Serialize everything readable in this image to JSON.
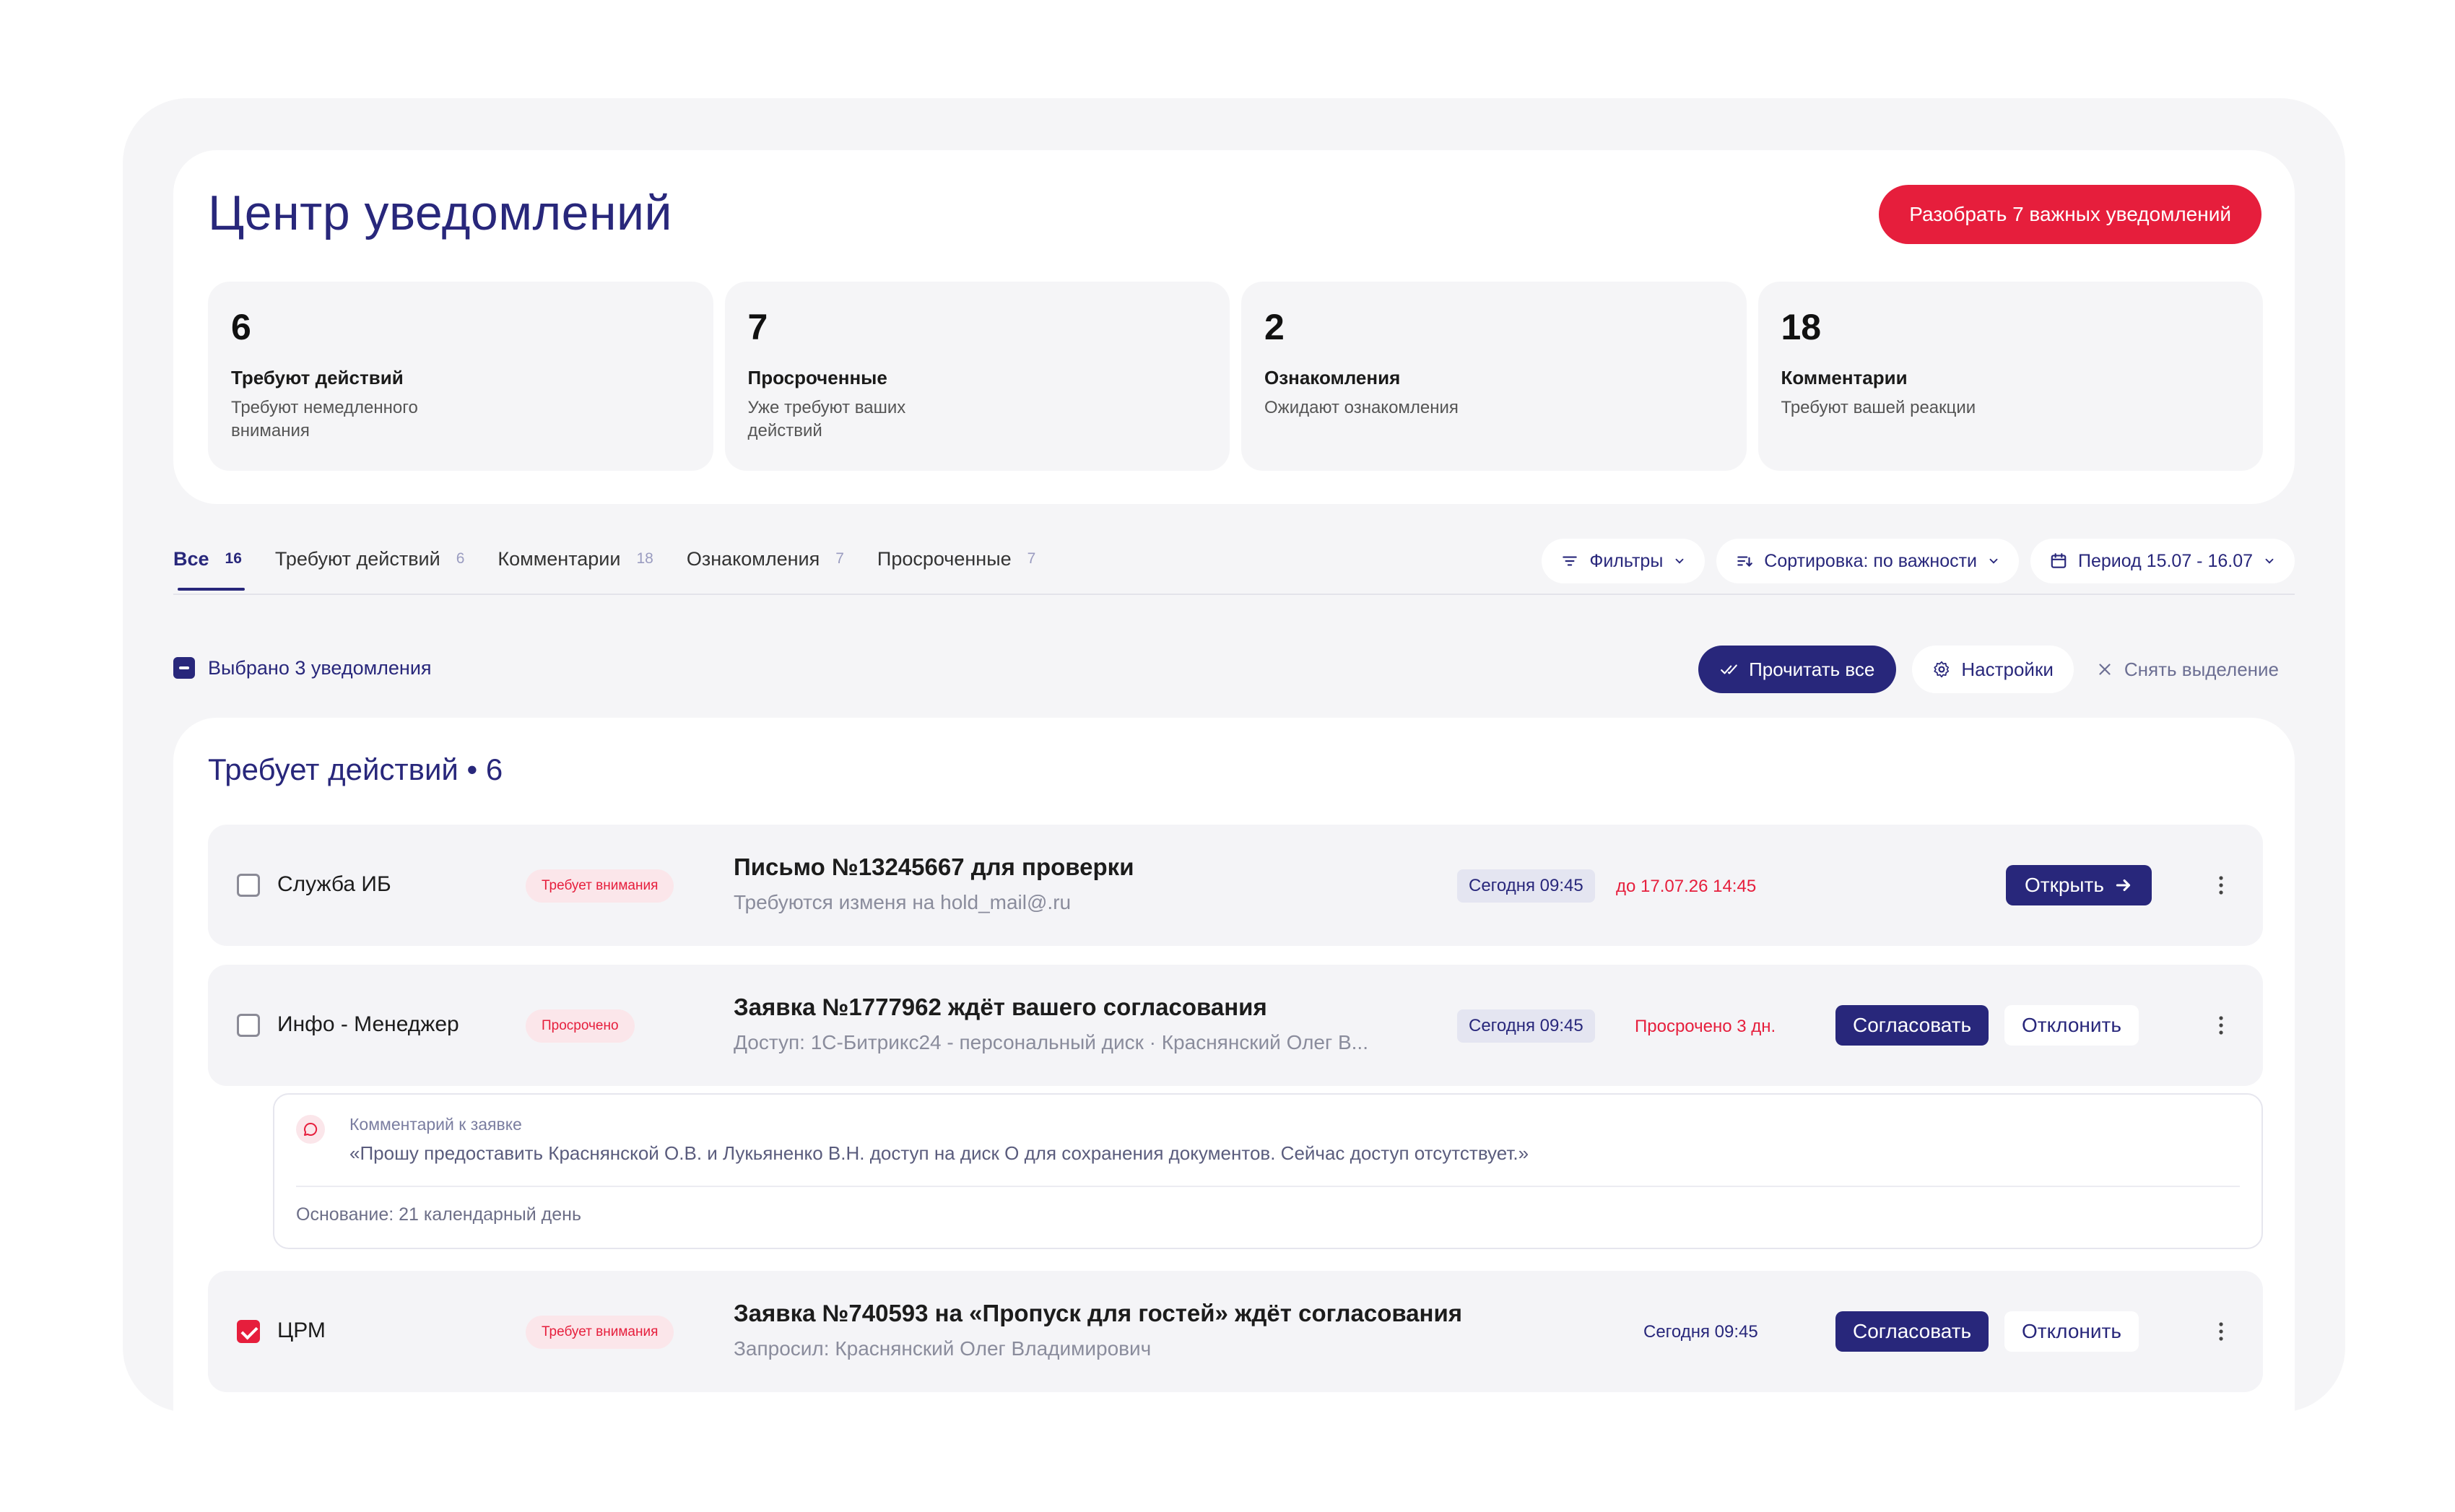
{
  "header": {
    "title": "Центр уведомлений",
    "cta_label": "Разобрать 7 важных уведомлений",
    "accent_color": "#e61e3c",
    "brand_color": "#28277b"
  },
  "stats": [
    {
      "value": "6",
      "title": "Требуют действий",
      "desc": "Требуют немедленного внимания"
    },
    {
      "value": "7",
      "title": "Просроченные",
      "desc": "Уже требуют ваших действий"
    },
    {
      "value": "2",
      "title": "Ознакомления",
      "desc": "Ожидают ознакомления"
    },
    {
      "value": "18",
      "title": "Комментарии",
      "desc": "Требуют вашей реакции"
    }
  ],
  "tabs": [
    {
      "label": "Все",
      "count": "16"
    },
    {
      "label": "Требуют действий",
      "count": "6"
    },
    {
      "label": "Комментарии",
      "count": "18"
    },
    {
      "label": "Ознакомления",
      "count": "7"
    },
    {
      "label": "Просроченные",
      "count": "7"
    }
  ],
  "toolbar": {
    "filters": "Фильтры",
    "sort": "Сортировка: по важности",
    "period": "Период 15.07 - 16.07"
  },
  "selection": {
    "label": "Выбрано 3 уведомления",
    "read_all": "Прочитать все",
    "settings": "Настройки",
    "clear": "Снять выделение"
  },
  "group": {
    "title": "Требует действий • 6"
  },
  "rows": [
    {
      "checked": false,
      "sender": "Служба ИБ",
      "badge": "Требует внимания",
      "title": "Письмо №13245667 для проверки",
      "subtitle": "Требуются изменя на hold_mail@.ru",
      "time": "Сегодня 09:45",
      "deadline": "до 17.07.26 14:45",
      "open_label": "Открыть"
    },
    {
      "checked": false,
      "sender": "Инфо - Менеджер",
      "badge": "Просрочено",
      "title": "Заявка  №1777962 ждёт вашего согласования",
      "subtitle": "Доступ: 1С-Битрикс24 - персональный диск · Краснянский Олег В...",
      "time": "Сегодня 09:45",
      "deadline": "Просрочено 3 дн.",
      "approve_label": "Согласовать",
      "reject_label": "Отклонить"
    },
    {
      "checked": true,
      "sender": "ЦРМ",
      "badge": "Требует внимания",
      "title": "Заявка №740593 на  «Пропуск для гостей» ждёт согласования",
      "subtitle": "Запросил: Краснянский Олег Владимирович",
      "time": "Сегодня 09:45",
      "approve_label": "Согласовать",
      "reject_label": "Отклонить"
    }
  ],
  "comment": {
    "label": "Комментарий к заявке",
    "text": "«Прошу предоставить Краснянской О.В. и Лукьяненко В.Н. доступ на диск О для сохранения документов. Сейчас доступ отсутствует.»",
    "basis": "Основание: 21 календарный день"
  }
}
